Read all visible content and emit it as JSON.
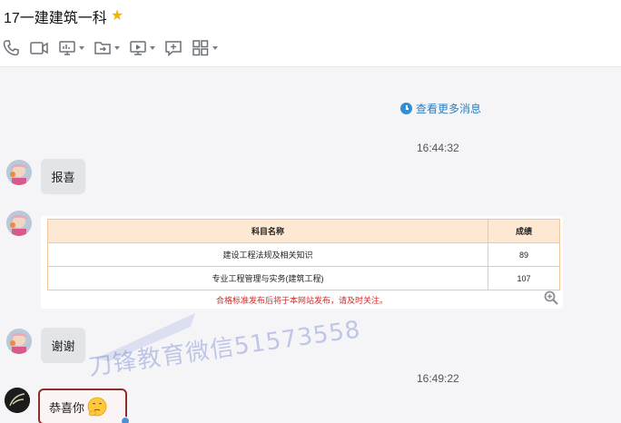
{
  "window": {
    "title": "17一建建筑一科"
  },
  "toolbar": {
    "icons": [
      "phone-icon",
      "video-icon",
      "screen-share-icon",
      "file-icon",
      "remote-desktop-icon",
      "add-app-icon",
      "grid-apps-icon"
    ]
  },
  "chat": {
    "more_link": "查看更多消息",
    "messages": [
      {
        "time": "16:44:32"
      },
      {
        "text": "报喜"
      },
      {
        "table": {
          "headers": [
            "科目名称",
            "成绩"
          ],
          "rows": [
            [
              "建设工程法规及相关知识",
              "89"
            ],
            [
              "专业工程管理与实务(建筑工程)",
              "107"
            ]
          ],
          "notice": "合格标准发布后将于本网站发布，请及时关注。"
        }
      },
      {
        "text": "谢谢"
      },
      {
        "time": "16:49:22"
      },
      {
        "text": "恭喜你"
      }
    ]
  },
  "watermark": "刀锋教育微信51573558",
  "colors": {
    "accent_link": "#2e7fc0",
    "notice_red": "#d02a2a",
    "table_border": "#f0c69a",
    "table_header_bg": "#fde9d3",
    "bubble_border": "#8e2d2d"
  }
}
